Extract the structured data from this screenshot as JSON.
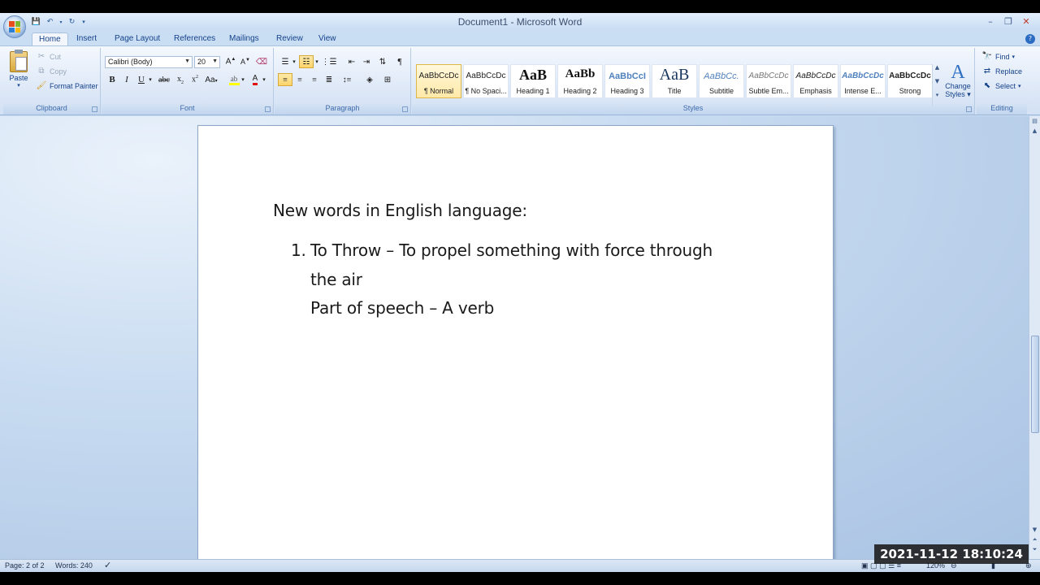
{
  "window": {
    "title": "Document1 - Microsoft Word"
  },
  "tabs": [
    "Home",
    "Insert",
    "Page Layout",
    "References",
    "Mailings",
    "Review",
    "View"
  ],
  "clipboard": {
    "label": "Clipboard",
    "paste": "Paste",
    "cut": "Cut",
    "copy": "Copy",
    "format_painter": "Format Painter"
  },
  "font": {
    "label": "Font",
    "family": "Calibri (Body)",
    "size": "20"
  },
  "paragraph": {
    "label": "Paragraph"
  },
  "styles": {
    "label": "Styles",
    "items": [
      {
        "sample": "AaBbCcDc",
        "name": "¶ Normal"
      },
      {
        "sample": "AaBbCcDc",
        "name": "¶ No Spaci..."
      },
      {
        "sample": "AaB",
        "name": "Heading 1"
      },
      {
        "sample": "AaBb",
        "name": "Heading 2"
      },
      {
        "sample": "AaBbCcI",
        "name": "Heading 3"
      },
      {
        "sample": "AaB",
        "name": "Title"
      },
      {
        "sample": "AaBbCc.",
        "name": "Subtitle"
      },
      {
        "sample": "AaBbCcDc",
        "name": "Subtle Em..."
      },
      {
        "sample": "AaBbCcDc",
        "name": "Emphasis"
      },
      {
        "sample": "AaBbCcDc",
        "name": "Intense E..."
      },
      {
        "sample": "AaBbCcDc",
        "name": "Strong"
      }
    ],
    "change_styles_1": "Change",
    "change_styles_2": "Styles"
  },
  "editing": {
    "label": "Editing",
    "find": "Find",
    "replace": "Replace",
    "select": "Select"
  },
  "document": {
    "heading": "New words in English language:",
    "item_number": "1.",
    "item_line1": "To Throw – To propel something with force through",
    "item_line2": "the air",
    "item_line3": "Part of speech – A verb"
  },
  "status": {
    "page": "Page: 2 of 2",
    "words": "Words: 240",
    "zoom": "120%"
  },
  "overlay": {
    "timestamp": "2021-11-12  18:10:24"
  },
  "colors": {
    "accent": "#15428b",
    "ribbon_bg": "#dfe9f7",
    "doc_bg": "#c9dcf1"
  }
}
